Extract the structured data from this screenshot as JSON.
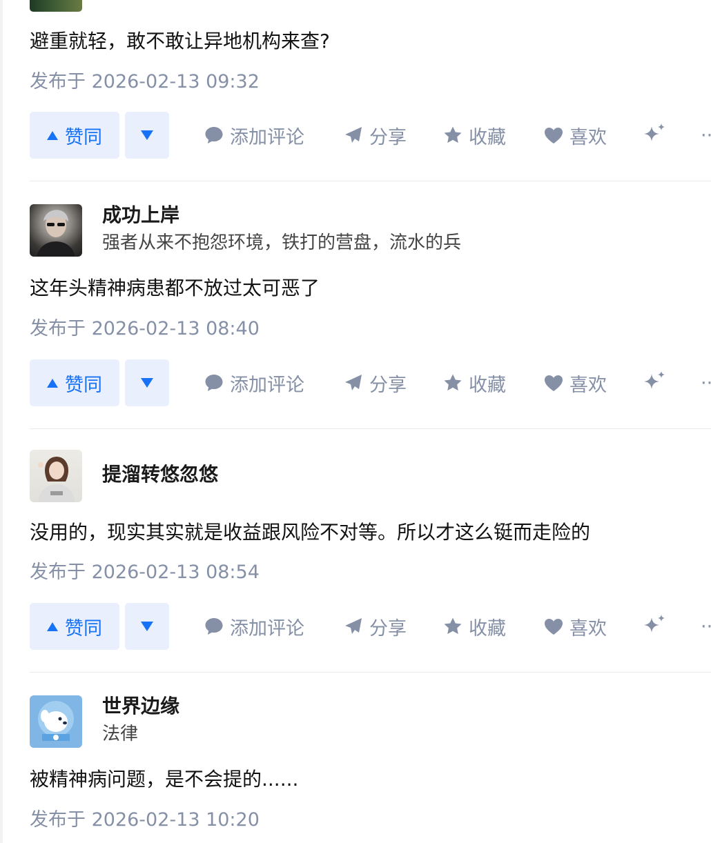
{
  "answers": [
    {
      "content": "避重就轻，敢不敢让异地机构来查?",
      "time": "发布于 2026-02-13 09:32"
    },
    {
      "author": {
        "name": "成功上岸",
        "bio": "强者从来不抱怨环境，铁打的营盘，流水的兵"
      },
      "content": "这年头精神病患都不放过太可恶了",
      "time": "发布于 2026-02-13 08:40"
    },
    {
      "author": {
        "name": "提溜转悠忽悠",
        "bio": ""
      },
      "content": "没用的，现实其实就是收益跟风险不对等。所以才这么铤而走险的",
      "time": "发布于 2026-02-13 08:54"
    },
    {
      "author": {
        "name": "世界边缘",
        "bio": "法律"
      },
      "content": "被精神病问题，是不会提的......",
      "time": "发布于 2026-02-13 10:20"
    }
  ],
  "actions": {
    "upvote": "赞同",
    "comment": "添加评论",
    "share": "分享",
    "collect": "收藏",
    "like": "喜欢",
    "more": "···"
  },
  "icons": {
    "upvote": "triangle-up-icon",
    "downvote": "triangle-down-icon",
    "comment": "speech-bubble-icon",
    "share": "paper-plane-icon",
    "collect": "star-icon",
    "like": "heart-icon",
    "ai": "sparkle-icon",
    "more": "ellipsis-icon"
  },
  "colors": {
    "accent": "#1772f6",
    "accent_bg": "#e9effc",
    "muted": "#8590a6",
    "text": "#121212",
    "divider": "#ebebeb"
  }
}
